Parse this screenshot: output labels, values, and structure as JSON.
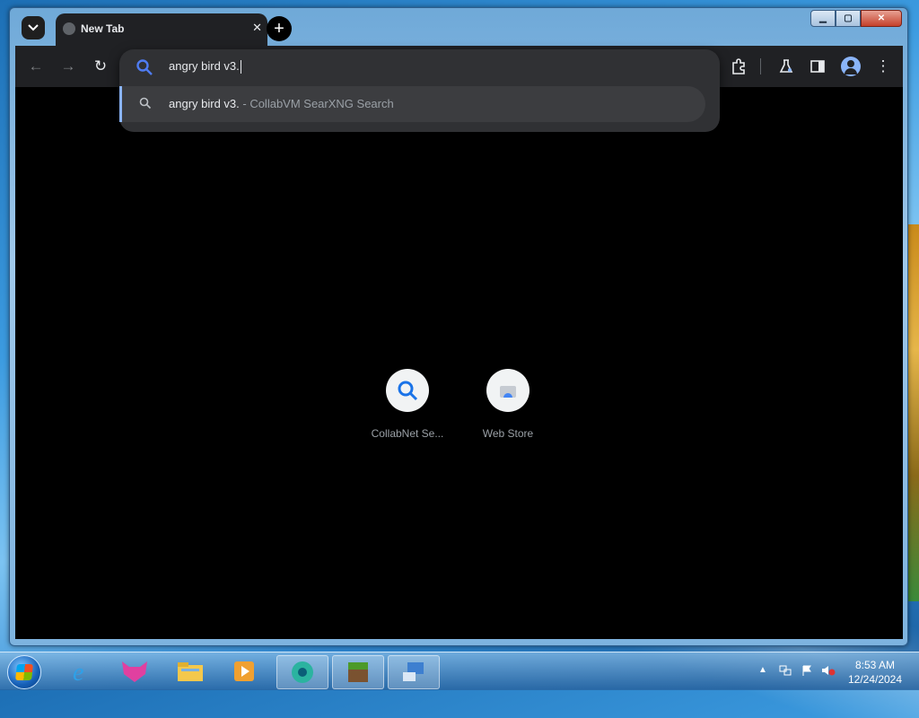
{
  "window": {
    "min_label": "▁",
    "max_label": "▢",
    "close_label": "✕"
  },
  "tabs": [
    {
      "title": "New Tab",
      "close_label": "✕"
    }
  ],
  "new_tab_label": "+",
  "toolbar": {
    "back_label": "←",
    "forward_label": "→",
    "reload_label": "↻",
    "extensions_icon": "puzzle-icon",
    "labs_icon": "flask-icon",
    "sidepanel_icon": "side-panel-icon",
    "menu_label": "⋮"
  },
  "omnibox": {
    "value": "angry bird v3."
  },
  "suggestions": [
    {
      "query": "angry bird v3.",
      "source": " - CollabVM SearXNG Search"
    }
  ],
  "shortcuts": [
    {
      "label": "CollabNet Se...",
      "icon": "search-icon"
    },
    {
      "label": "Web Store",
      "icon": "web-store-icon"
    }
  ],
  "taskbar": {
    "apps": [
      "internet-explorer-icon",
      "cat-app-icon",
      "file-explorer-icon",
      "media-player-icon",
      "browser-icon",
      "minecraft-icon",
      "network-computer-icon"
    ],
    "clock_time": "8:53 AM",
    "clock_date": "12/24/2024"
  },
  "colors": {
    "accent": "#8ab4f8",
    "toolbar": "#202124",
    "omnibox": "#303134"
  }
}
